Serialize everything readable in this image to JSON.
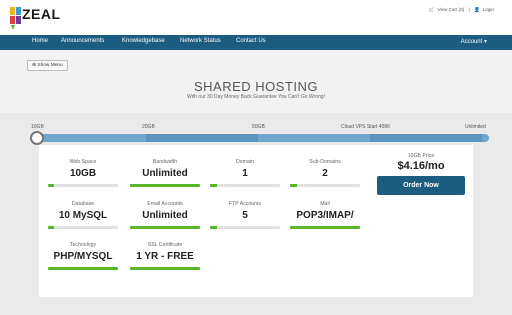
{
  "brand": {
    "logo_text": "ZEAL"
  },
  "top_links": {
    "cart": "View Cart (0)",
    "login": "Login"
  },
  "nav": {
    "items": [
      "Home",
      "Announcements",
      "Knowledgebase",
      "Network Status",
      "Contact Us"
    ],
    "account": "Account"
  },
  "show_menu": "Show Menu",
  "hero": {
    "title": "SHARED HOSTING",
    "subtitle": "With our 30 Day Money Back Guarantee You Can't Go Wrong!"
  },
  "slider": {
    "labels": [
      "10GB",
      "20GB",
      "50GB",
      "Cloud VPS Start 4096",
      "Unlimited"
    ],
    "selected": "10GB"
  },
  "features": [
    {
      "label": "Web Space",
      "value": "10GB",
      "level": 0.08
    },
    {
      "label": "Bandwidth",
      "value": "Unlimited",
      "level": 1.0
    },
    {
      "label": "Domain",
      "value": "1",
      "level": 0.1
    },
    {
      "label": "Sub-Domains",
      "value": "2",
      "level": 0.1
    },
    {
      "label": "Database",
      "value": "10 MySQL",
      "level": 0.08
    },
    {
      "label": "Email Accounts",
      "value": "Unlimited",
      "level": 1.0
    },
    {
      "label": "FTP Accounts",
      "value": "5",
      "level": 0.1
    },
    {
      "label": "Mail",
      "value": "POP3/IMAP/",
      "level": 1.0
    },
    {
      "label": "Technology",
      "value": "PHP/MYSQL",
      "level": 1.0
    },
    {
      "label": "SSL Certificate",
      "value": "1 YR - FREE",
      "level": 1.0
    }
  ],
  "price": {
    "label": "10GB Price",
    "value": "$4.16/mo",
    "order_label": "Order Now"
  },
  "colors": {
    "nav": "#1c5c80",
    "accent_green": "#58b82a",
    "slider": "#6fa6cc"
  }
}
